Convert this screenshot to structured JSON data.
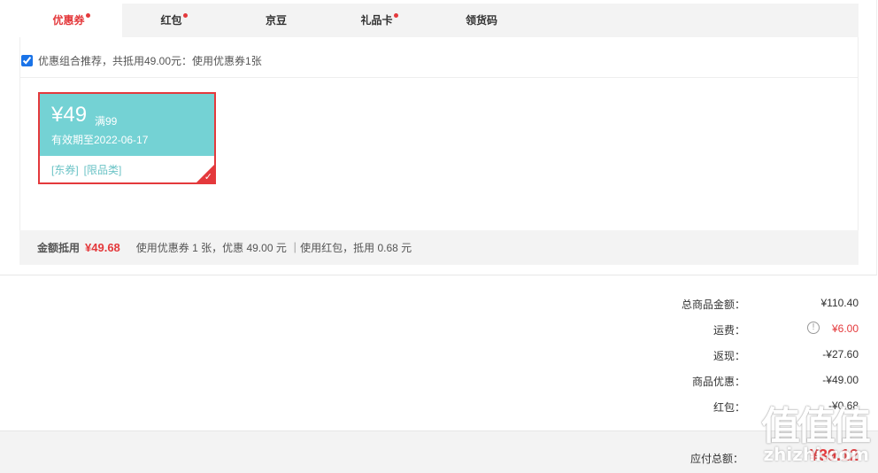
{
  "tabs": [
    {
      "label": "优惠券",
      "active": true,
      "dot": true
    },
    {
      "label": "红包",
      "active": false,
      "dot": true
    },
    {
      "label": "京豆",
      "active": false,
      "dot": false
    },
    {
      "label": "礼品卡",
      "active": false,
      "dot": true
    },
    {
      "label": "领货码",
      "active": false,
      "dot": false
    }
  ],
  "combo": {
    "checked": true,
    "text": "优惠组合推荐，共抵用49.00元：使用优惠券1张"
  },
  "coupon": {
    "amount": "¥49",
    "condition": "满99",
    "expiry": "有效期至2022-06-17",
    "tags": [
      "[东券]",
      "[限品类]"
    ],
    "selected": true,
    "color": "#74d2d4"
  },
  "summary": {
    "label": "金额抵用",
    "amount": "¥49.68",
    "detail": "使用优惠券 1 张，优惠 49.00 元 ｜使用红包，抵用 0.68 元"
  },
  "prices": [
    {
      "label": "总商品金额：",
      "value": "¥110.40"
    },
    {
      "label": "运费：",
      "value": "¥6.00",
      "info_icon": true,
      "highlight": true
    },
    {
      "label": "返现：",
      "value": "-¥27.60"
    },
    {
      "label": "商品优惠：",
      "value": "-¥49.00"
    },
    {
      "label": "红包：",
      "value": "-¥0.68"
    }
  ],
  "total": {
    "label": "应付总额：",
    "value": "¥39.12"
  },
  "watermark": {
    "logo": "值值值",
    "site": "zhizhi.com"
  },
  "colors": {
    "accent": "#e4393c",
    "coupon_bg": "#74d2d4",
    "checkbox": "#1a73e8"
  }
}
